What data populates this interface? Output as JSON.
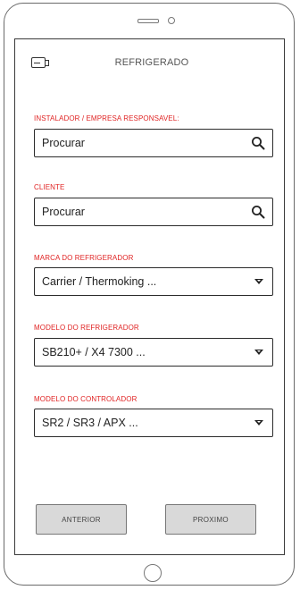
{
  "header": {
    "title": "REFRIGERADO",
    "icon": "refrigerator-icon"
  },
  "form": {
    "installer_label": "INSTALADOR / EMPRESA RESPONSAVEL:",
    "installer_value": "Procurar",
    "client_label": "CLIENTE",
    "client_value": "Procurar",
    "brand_label": "MARCA DO REFRIGERADOR",
    "brand_value": "Carrier / Thermoking ...",
    "model_label": "MODELO DO REFRIGERADOR",
    "model_value": "SB210+ / X4 7300 ...",
    "controller_label": "MODELO DO CONTROLADOR",
    "controller_value": "SR2 / SR3 / APX ..."
  },
  "footer": {
    "previous_label": "ANTERIOR",
    "next_label": "PROXIMO"
  },
  "colors": {
    "label": "#e02424",
    "button_bg": "#d9d9d9"
  }
}
